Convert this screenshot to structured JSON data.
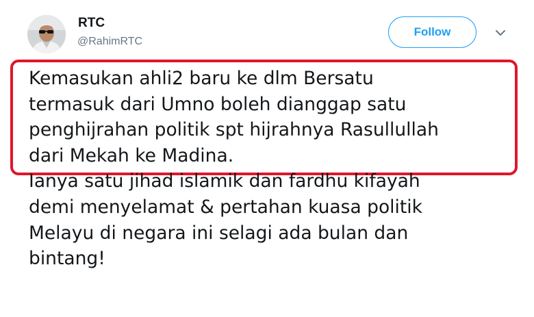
{
  "tweet": {
    "author": {
      "display_name": "RTC",
      "handle": "@RahimRTC"
    },
    "follow_label": "Follow",
    "text_lines": [
      "Kemasukan ahli2 baru ke dlm Bersatu",
      "termasuk dari Umno boleh dianggap satu",
      "penghijrahan politik spt hijrahnya Rasullullah",
      "dari Mekah ke Madina.",
      "Ianya satu jihad islamik dan fardhu kifayah",
      "demi menyelamat & pertahan kuasa politik",
      "Melayu di negara ini selagi ada bulan dan",
      "bintang!"
    ]
  },
  "colors": {
    "accent": "#1da1f2",
    "highlight_border": "#e0162b",
    "text": "#14171a",
    "secondary_text": "#657786"
  },
  "icons": {
    "menu": "chevron-down-icon"
  }
}
